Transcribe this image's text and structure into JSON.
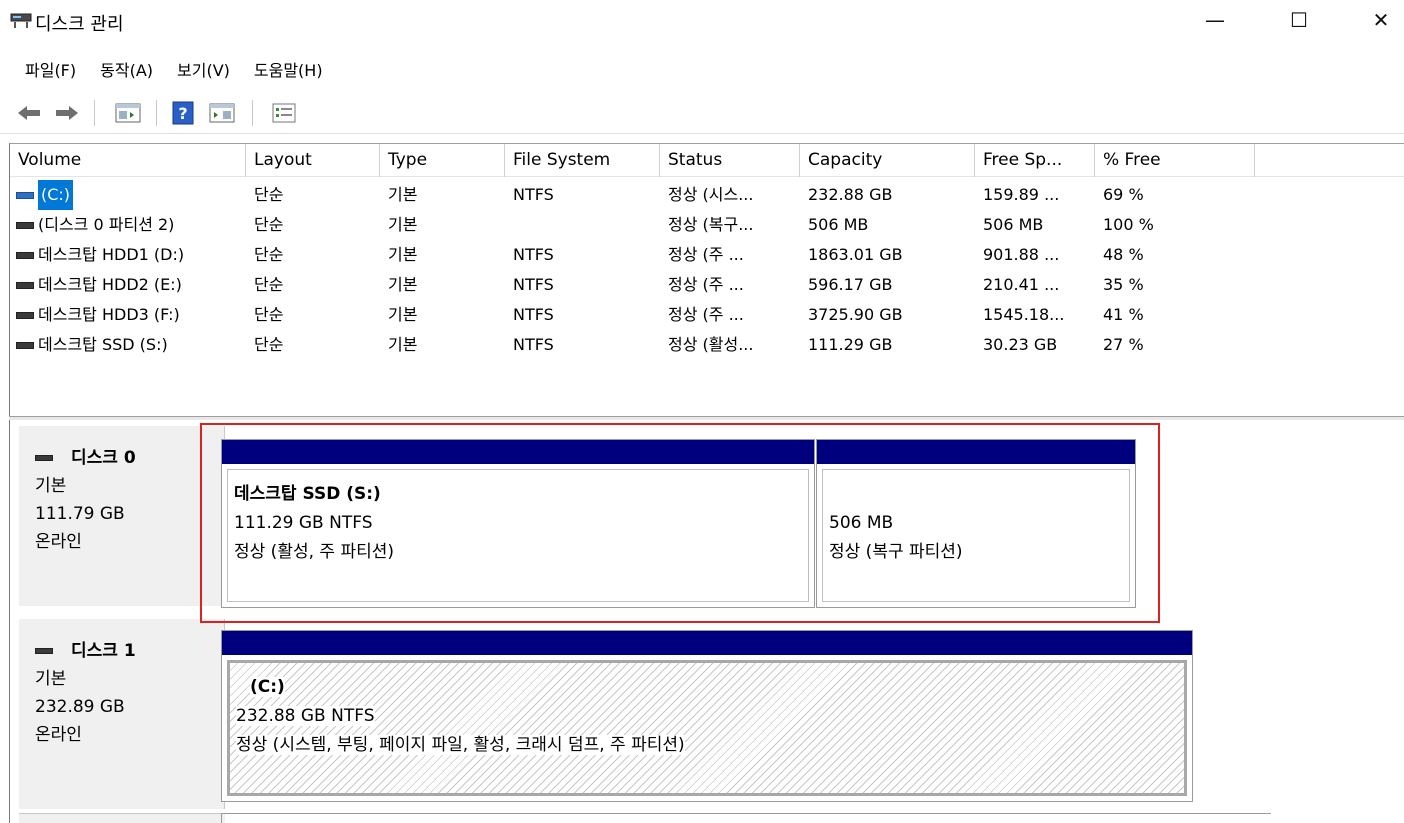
{
  "window": {
    "title": "디스크 관리",
    "controls": {
      "minimize": "—",
      "maximize": "☐",
      "close": "✕"
    }
  },
  "menu": [
    "파일(F)",
    "동작(A)",
    "보기(V)",
    "도움말(H)"
  ],
  "toolbar": [
    "back-icon",
    "forward-icon",
    "console-tree-icon",
    "help-icon",
    "action-pane-icon",
    "properties-icon"
  ],
  "volume_table": {
    "columns": [
      "Volume",
      "Layout",
      "Type",
      "File System",
      "Status",
      "Capacity",
      "Free Sp...",
      "% Free"
    ],
    "rows": [
      {
        "volume": "(C:)",
        "layout": "단순",
        "type": "기본",
        "fs": "NTFS",
        "status": "정상 (시스...",
        "capacity": "232.88 GB",
        "free": "159.89 ...",
        "pct": "69 %",
        "selected": true
      },
      {
        "volume": "(디스크 0 파티션 2)",
        "layout": "단순",
        "type": "기본",
        "fs": "",
        "status": "정상 (복구...",
        "capacity": "506 MB",
        "free": "506 MB",
        "pct": "100 %"
      },
      {
        "volume": "데스크탑 HDD1 (D:)",
        "layout": "단순",
        "type": "기본",
        "fs": "NTFS",
        "status": "정상 (주 ...",
        "capacity": "1863.01 GB",
        "free": "901.88 ...",
        "pct": "48 %"
      },
      {
        "volume": "데스크탑 HDD2 (E:)",
        "layout": "단순",
        "type": "기본",
        "fs": "NTFS",
        "status": "정상 (주 ...",
        "capacity": "596.17 GB",
        "free": "210.41 ...",
        "pct": "35 %"
      },
      {
        "volume": "데스크탑 HDD3 (F:)",
        "layout": "단순",
        "type": "기본",
        "fs": "NTFS",
        "status": "정상 (주 ...",
        "capacity": "3725.90 GB",
        "free": "1545.18...",
        "pct": "41 %"
      },
      {
        "volume": "데스크탑 SSD (S:)",
        "layout": "단순",
        "type": "기본",
        "fs": "NTFS",
        "status": "정상 (활성...",
        "capacity": "111.29 GB",
        "free": "30.23 GB",
        "pct": "27 %"
      }
    ]
  },
  "disks": [
    {
      "name": "디스크 0",
      "type": "기본",
      "size": "111.79 GB",
      "state": "온라인",
      "partitions": [
        {
          "title": "데스크탑 SSD  (S:)",
          "size_fs": "111.29 GB NTFS",
          "status": "정상 (활성, 주 파티션)"
        },
        {
          "title": "",
          "size_fs": "506 MB",
          "status": "정상 (복구 파티션)"
        }
      ]
    },
    {
      "name": "디스크 1",
      "type": "기본",
      "size": "232.89 GB",
      "state": "온라인",
      "partitions": [
        {
          "title": "(C:)",
          "size_fs": "232.88 GB NTFS",
          "status": "정상 (시스템, 부팅, 페이지 파일, 활성, 크래시 덤프, 주 파티션)"
        }
      ]
    }
  ],
  "colors": {
    "partition_header": "#00007f",
    "highlight": "#e02020",
    "selection": "#0078d7"
  }
}
